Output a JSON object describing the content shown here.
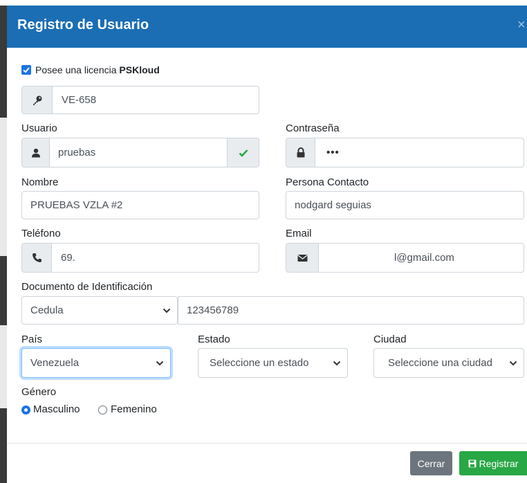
{
  "modal": {
    "title": "Registro de Usuario",
    "close_glyph": "×"
  },
  "license": {
    "checked": true,
    "label_prefix": "Posee una licencia ",
    "label_brand": "PSKloud",
    "value": "VE-658",
    "icon": "key-icon"
  },
  "usuario": {
    "label": "Usuario",
    "value": "pruebas",
    "icon": "user-icon",
    "validation_icon": "check-icon",
    "validation_color": "#28a745"
  },
  "contrasena": {
    "label": "Contraseña",
    "value": "•••",
    "icon": "lock-icon"
  },
  "nombre": {
    "label": "Nombre",
    "value": "PRUEBAS VZLA #2"
  },
  "contacto": {
    "label": "Persona Contacto",
    "value": "nodgard seguias"
  },
  "telefono": {
    "label": "Teléfono",
    "value": "69.",
    "icon": "phone-icon"
  },
  "email": {
    "label": "Email",
    "value": "l@gmail.com",
    "icon": "envelope-icon"
  },
  "documento": {
    "label": "Documento de Identificación",
    "type": "Cedula",
    "number": "123456789"
  },
  "pais": {
    "label": "País",
    "value": "Venezuela"
  },
  "estado": {
    "label": "Estado",
    "value": "Seleccione un estado"
  },
  "ciudad": {
    "label": "Ciudad",
    "value": "Seleccione una ciudad"
  },
  "genero": {
    "label": "Género",
    "options": [
      "Masculino",
      "Femenino"
    ],
    "selected": "Masculino"
  },
  "footer": {
    "cancel_label": "Cerrar",
    "submit_label": "Registrar",
    "submit_icon": "save-icon"
  },
  "colors": {
    "header": "#1b6eb4",
    "primary": "#1b74e4",
    "success": "#28a745",
    "secondary": "#6c757d"
  }
}
